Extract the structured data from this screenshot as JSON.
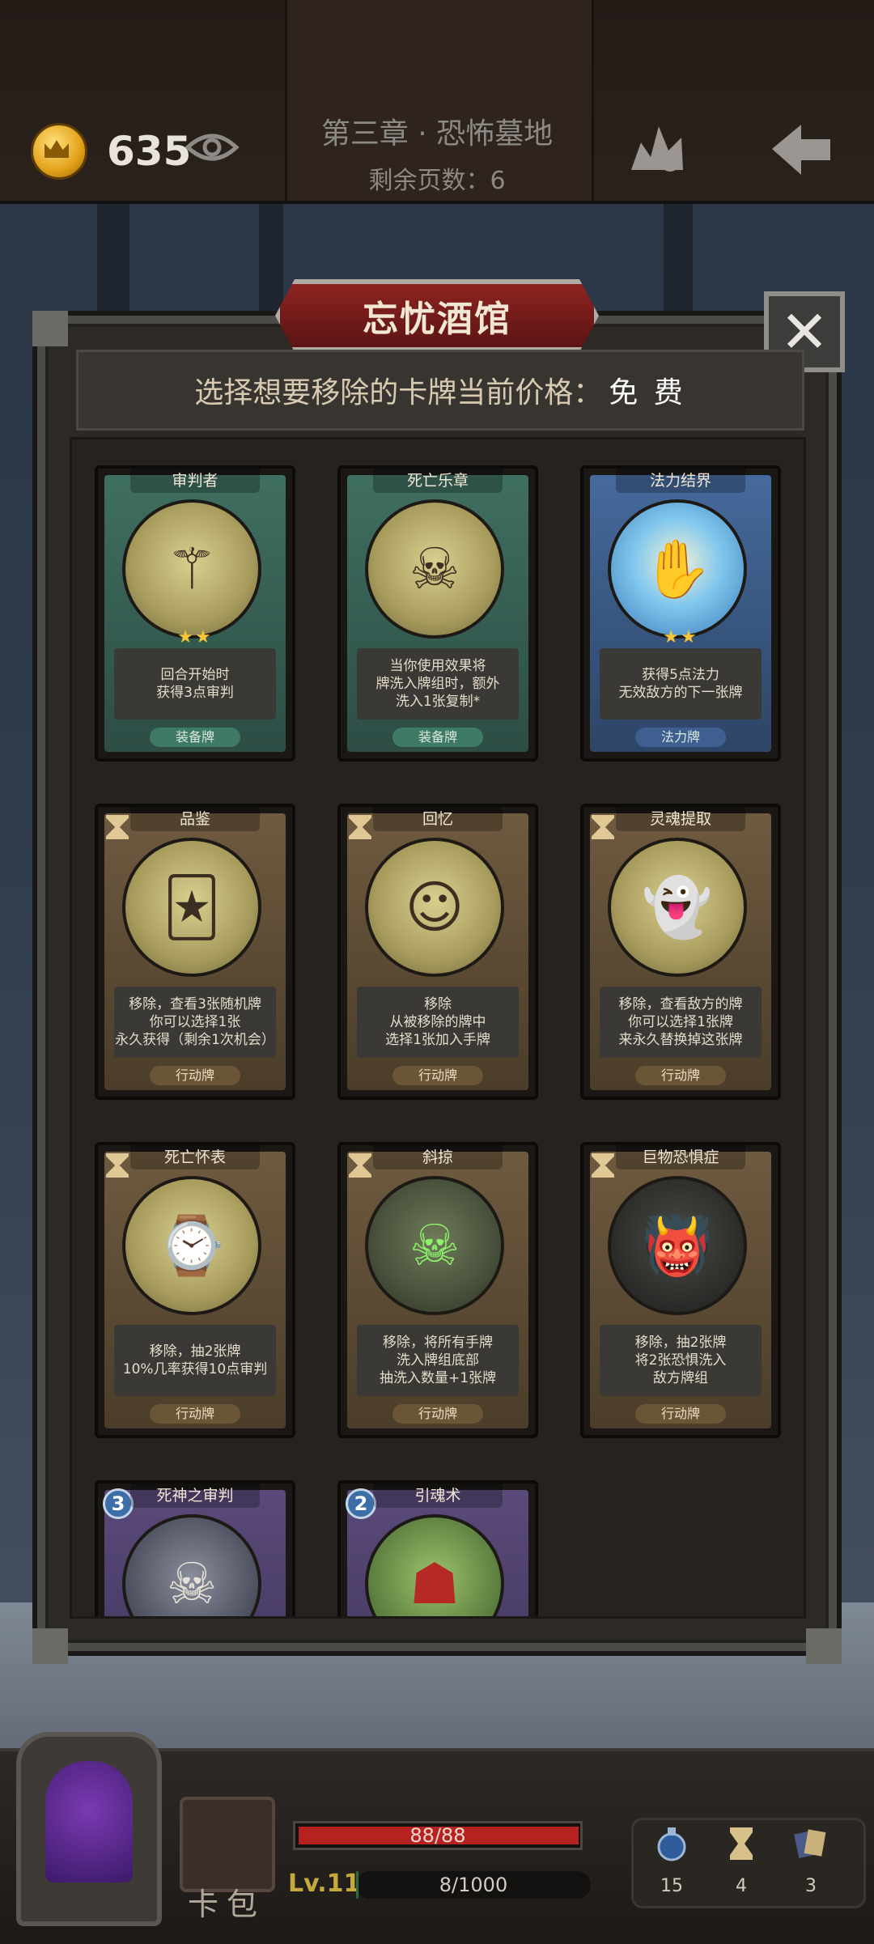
{
  "header": {
    "gold": "635",
    "chapter": "第三章 · 恐怖墓地",
    "pages_label": "剩余页数：",
    "pages_value": "6"
  },
  "popup": {
    "title": "忘忧酒馆",
    "prompt": "选择想要移除的卡牌当前价格：",
    "price": "免 费",
    "close_glyph": "✕"
  },
  "cards": [
    {
      "name": "审判者",
      "stars": "★★",
      "desc": [
        "回合开始时",
        "获得3点审判"
      ],
      "type": "装备牌"
    },
    {
      "name": "死亡乐章",
      "stars": "",
      "desc": [
        "当你使用效果将",
        "牌洗入牌组时，额外",
        "洗入1张复制*"
      ],
      "type": "装备牌"
    },
    {
      "name": "法力结界",
      "stars": "★★",
      "desc": [
        "获得5点法力",
        "无效敌方的下一张牌"
      ],
      "type": "法力牌"
    },
    {
      "name": "品鉴",
      "desc": [
        "移除，查看3张随机牌",
        "你可以选择1张",
        "永久获得（剩余1次机会）"
      ],
      "type": "行动牌"
    },
    {
      "name": "回忆",
      "desc": [
        "移除",
        "从被移除的牌中",
        "选择1张加入手牌"
      ],
      "type": "行动牌"
    },
    {
      "name": "灵魂提取",
      "desc": [
        "移除，查看敌方的牌",
        "你可以选择1张牌",
        "来永久替换掉这张牌"
      ],
      "type": "行动牌"
    },
    {
      "name": "死亡怀表",
      "desc": [
        "移除，抽2张牌",
        "10%几率获得10点审判"
      ],
      "type": "行动牌"
    },
    {
      "name": "斜掠",
      "desc": [
        "移除，将所有手牌",
        "洗入牌组底部",
        "抽洗入数量+1张牌"
      ],
      "type": "行动牌"
    },
    {
      "name": "巨物恐惧症",
      "desc": [
        "移除，抽2张牌",
        "将2张恐惧洗入",
        "敌方牌组"
      ],
      "type": "行动牌"
    },
    {
      "name": "死神之审判",
      "cost": "3"
    },
    {
      "name": "引魂术",
      "cost": "2"
    }
  ],
  "bottom": {
    "deck_label": "卡包",
    "hp": "88/88",
    "level": "Lv.11",
    "xp": "8/1000",
    "res1": "15",
    "res2": "4",
    "res3": "3"
  }
}
